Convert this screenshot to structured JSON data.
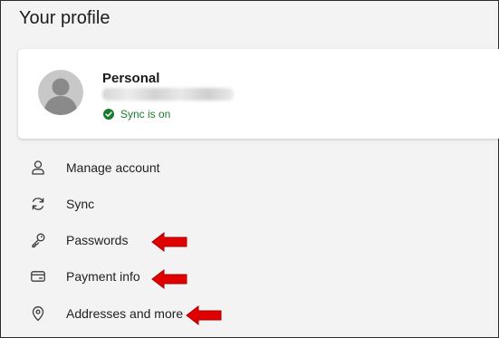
{
  "header": {
    "title": "Your profile"
  },
  "profile": {
    "name": "Personal",
    "sync_status": "Sync is on",
    "sync_color": "#1a7a2e"
  },
  "menu": {
    "items": [
      {
        "label": "Manage account",
        "icon": "person-icon"
      },
      {
        "label": "Sync",
        "icon": "sync-icon"
      },
      {
        "label": "Passwords",
        "icon": "key-icon"
      },
      {
        "label": "Payment info",
        "icon": "card-icon"
      },
      {
        "label": "Addresses and more",
        "icon": "location-pin-icon"
      }
    ]
  },
  "annotation": {
    "arrow_color": "#e00000"
  }
}
